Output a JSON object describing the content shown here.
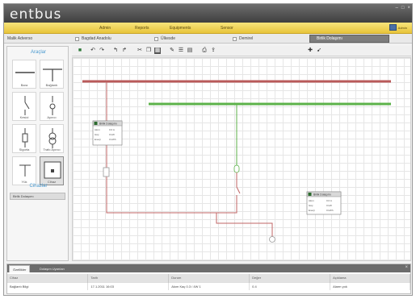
{
  "app": {
    "title": "entbus"
  },
  "menu": {
    "items": [
      "Admin",
      "Reports",
      "Equipments",
      "Sensor"
    ],
    "user": "Admin"
  },
  "window_controls": [
    "–",
    "□",
    "×"
  ],
  "filters": [
    {
      "label": "Malik Adverso",
      "selected": false
    },
    {
      "label": "Bagdad Anadolu",
      "selected": false
    },
    {
      "label": "Ülkesde",
      "selected": false
    },
    {
      "label": "Demirel",
      "selected": false
    },
    {
      "label": "Birlik Dolaşımı",
      "selected": true
    }
  ],
  "left_panel": {
    "section_title": "Araçlar",
    "symbols": [
      {
        "label": "Bara"
      },
      {
        "label": "Bağlantı"
      },
      {
        "label": "Kesici"
      },
      {
        "label": "Ayırıcı"
      },
      {
        "label": "Sigorta"
      },
      {
        "label": "Trafo Ayırıcı"
      },
      {
        "label": "Yük"
      },
      {
        "label": "Cihaz"
      }
    ],
    "section2_title": "Cihazlar",
    "section2_item": "Birlik Dolaşımı"
  },
  "toolbar": {
    "icons": [
      "save-icon",
      "undo-icon",
      "redo-icon",
      "undo-arrow-icon",
      "redo-arrow-icon",
      "cut-icon",
      "copy-icon",
      "grid-icon",
      "pen-icon",
      "list-icon",
      "table-icon",
      "print-icon",
      "export-icon",
      "zoom-icon",
      "pointer-icon"
    ]
  },
  "canvas": {
    "devices": [
      {
        "id": "d1",
        "title": "Birlik Dolaşımı",
        "rows": [
          [
            "Akım",
            "0.0 A"
          ],
          [
            "Güç",
            "0 kW"
          ],
          [
            "Enerji",
            "0 kWh"
          ]
        ]
      },
      {
        "id": "d2",
        "title": "Birlik Dolaşımı",
        "rows": [
          [
            "Akım",
            "0.0 A"
          ],
          [
            "Güç",
            "0 kW"
          ],
          [
            "Enerji",
            "0 kWh"
          ]
        ]
      }
    ]
  },
  "bottom": {
    "tabs": [
      {
        "label": "Özellikler",
        "active": true
      },
      {
        "label": "Dolaşım Uyarıları",
        "active": false
      }
    ],
    "table": {
      "headers": [
        "Cihaz",
        "Tarih",
        "Durum",
        "Değer",
        "Açıklama"
      ],
      "rows": [
        [
          "Bağlantı Bilgi",
          "17.1.2011 16:03",
          "Akım Kaç 0.3 / 4W 1",
          "0.4",
          "Alarm yok"
        ]
      ]
    }
  },
  "colors": {
    "accent": "#f0d451",
    "bus_red": "#b95a5a",
    "bus_green": "#5cb24a",
    "line_red": "#c06565"
  }
}
